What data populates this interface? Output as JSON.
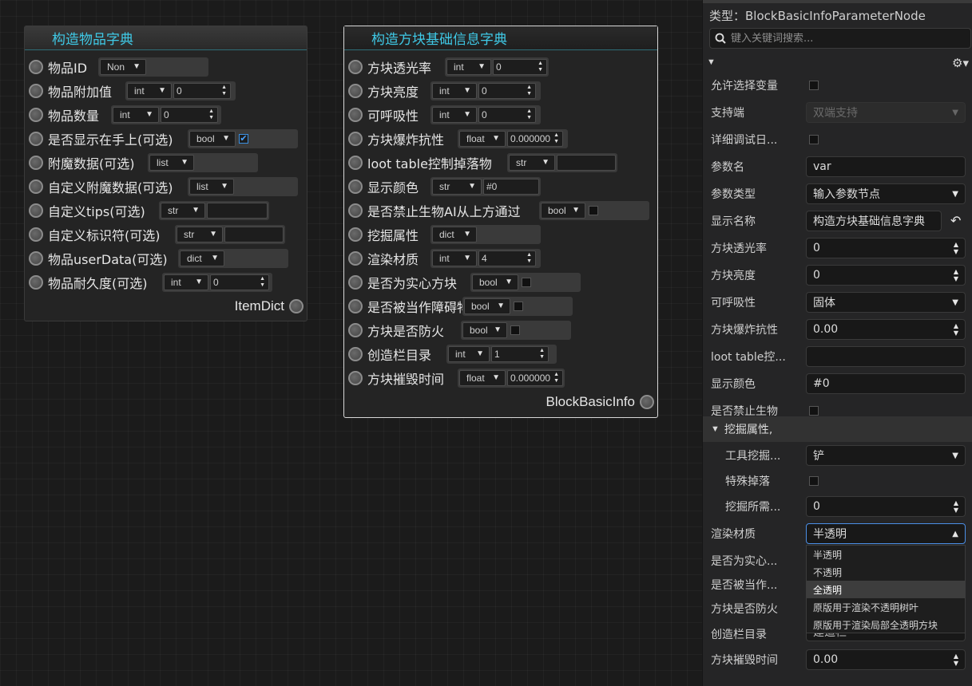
{
  "node_item": {
    "title": "构造物品字典",
    "rows": [
      {
        "label": "物品ID",
        "type": "Non",
        "value": null,
        "kind": "none"
      },
      {
        "label": "物品附加值",
        "type": "int",
        "value": "0",
        "kind": "num"
      },
      {
        "label": "物品数量",
        "type": "int",
        "value": "0",
        "kind": "num"
      },
      {
        "label": "是否显示在手上(可选)",
        "type": "bool",
        "value": "",
        "kind": "bool_on"
      },
      {
        "label": "附魔数据(可选)",
        "type": "list",
        "value": "",
        "kind": "none"
      },
      {
        "label": "自定义附魔数据(可选)",
        "type": "list",
        "value": "",
        "kind": "none"
      },
      {
        "label": "自定义tips(可选)",
        "type": "str",
        "value": "",
        "kind": "text"
      },
      {
        "label": "自定义标识符(可选)",
        "type": "str",
        "value": "",
        "kind": "text"
      },
      {
        "label": "物品userData(可选)",
        "type": "dict",
        "value": "",
        "kind": "none"
      },
      {
        "label": "物品耐久度(可选)",
        "type": "int",
        "value": "0",
        "kind": "num"
      }
    ],
    "output": "ItemDict"
  },
  "node_block": {
    "title": "构造方块基础信息字典",
    "rows": [
      {
        "label": "方块透光率",
        "type": "int",
        "value": "0",
        "kind": "num"
      },
      {
        "label": "方块亮度",
        "type": "int",
        "value": "0",
        "kind": "num"
      },
      {
        "label": "可呼吸性",
        "type": "int",
        "value": "0",
        "kind": "num"
      },
      {
        "label": "方块爆炸抗性",
        "type": "float",
        "value": "0.000000",
        "kind": "num"
      },
      {
        "label": "loot table控制掉落物",
        "type": "str",
        "value": "",
        "kind": "text"
      },
      {
        "label": "显示颜色",
        "type": "str",
        "value": "#0",
        "kind": "text"
      },
      {
        "label": "是否禁止生物AI从上方通过",
        "type": "bool",
        "value": "",
        "kind": "bool"
      },
      {
        "label": "挖掘属性",
        "type": "dict",
        "value": "",
        "kind": "none"
      },
      {
        "label": "渲染材质",
        "type": "int",
        "value": "4",
        "kind": "num"
      },
      {
        "label": "是否为实心方块",
        "type": "bool",
        "value": "",
        "kind": "bool"
      },
      {
        "label": "是否被当作障碍物",
        "type": "bool",
        "value": "",
        "kind": "bool"
      },
      {
        "label": "方块是否防火",
        "type": "bool",
        "value": "",
        "kind": "bool"
      },
      {
        "label": "创造栏目录",
        "type": "int",
        "value": "1",
        "kind": "num"
      },
      {
        "label": "方块摧毁时间",
        "type": "float",
        "value": "0.000000",
        "kind": "num"
      }
    ],
    "output": "BlockBasicInfo"
  },
  "panel": {
    "type_line": "类型：BlockBasicInfoParameterNode",
    "search_placeholder": "键入关键词搜索...",
    "rows": [
      {
        "label": "允许选择变量",
        "ctrl": "checkbox",
        "value": ""
      },
      {
        "label": "支持端",
        "ctrl": "select-disabled",
        "value": "双端支持"
      },
      {
        "label": "详细调试日...",
        "ctrl": "checkbox",
        "value": ""
      },
      {
        "label": "参数名",
        "ctrl": "text",
        "value": "var"
      },
      {
        "label": "参数类型",
        "ctrl": "select",
        "value": "输入参数节点"
      },
      {
        "label": "显示名称",
        "ctrl": "text-back",
        "value": "构造方块基础信息字典"
      },
      {
        "label": "方块透光率",
        "ctrl": "spin",
        "value": "0"
      },
      {
        "label": "方块亮度",
        "ctrl": "spin",
        "value": "0"
      },
      {
        "label": "可呼吸性",
        "ctrl": "select",
        "value": "固体"
      },
      {
        "label": "方块爆炸抗性",
        "ctrl": "spin",
        "value": "0.00"
      },
      {
        "label": "loot table控...",
        "ctrl": "text",
        "value": ""
      },
      {
        "label": "显示颜色",
        "ctrl": "text",
        "value": "#0"
      },
      {
        "label": "是否禁止生物",
        "ctrl": "checkbox",
        "value": ""
      }
    ],
    "section": "挖掘属性,",
    "sub_rows": [
      {
        "label": "工具挖掘...",
        "ctrl": "select",
        "value": "铲"
      },
      {
        "label": "特殊掉落",
        "ctrl": "checkbox",
        "value": ""
      },
      {
        "label": "挖掘所需...",
        "ctrl": "spin",
        "value": "0"
      }
    ],
    "rows2": [
      {
        "label": "渲染材质",
        "ctrl": "select-open",
        "value": "半透明"
      },
      {
        "label": "是否为实心...",
        "ctrl": "none",
        "value": ""
      },
      {
        "label": "是否被当作...",
        "ctrl": "none",
        "value": ""
      },
      {
        "label": "方块是否防火",
        "ctrl": "none",
        "value": ""
      },
      {
        "label": "创造栏目录",
        "ctrl": "none",
        "value": ""
      },
      {
        "label": "方块摧毁时间",
        "ctrl": "spin",
        "value": "0.00"
      }
    ],
    "dropdown_options": [
      "半透明",
      "不透明",
      "全透明",
      "原版用于渲染不透明树叶",
      "原版用于渲染局部全透明方块"
    ],
    "dropdown_highlighted": 2,
    "partial_text": "建造栏"
  }
}
